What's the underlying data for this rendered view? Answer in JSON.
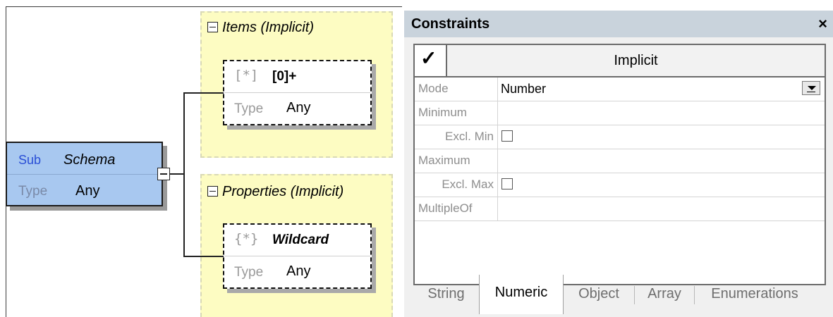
{
  "diagram": {
    "schema": {
      "sub_label": "Sub",
      "name": "Schema",
      "type_label": "Type",
      "type_value": "Any"
    },
    "items_group": {
      "title": "Items (Implicit)",
      "node": {
        "glyph": "[*]",
        "name": "[0]+",
        "type_label": "Type",
        "type_value": "Any"
      }
    },
    "properties_group": {
      "title": "Properties (Implicit)",
      "node": {
        "glyph": "{*}",
        "name": "Wildcard",
        "type_label": "Type",
        "type_value": "Any"
      }
    }
  },
  "panel": {
    "title": "Constraints",
    "close_glyph": "×",
    "header": {
      "check_glyph": "✓",
      "label": "Implicit"
    },
    "rows": [
      {
        "label": "Mode",
        "value": "Number"
      },
      {
        "label": "Minimum",
        "value": ""
      },
      {
        "label": "Excl. Min",
        "checked": false
      },
      {
        "label": "Maximum",
        "value": ""
      },
      {
        "label": "Excl. Max",
        "checked": false
      },
      {
        "label": "MultipleOf",
        "value": ""
      }
    ],
    "tabs": [
      "String",
      "Numeric",
      "Object",
      "Array",
      "Enumerations"
    ],
    "active_tab": "Numeric"
  }
}
